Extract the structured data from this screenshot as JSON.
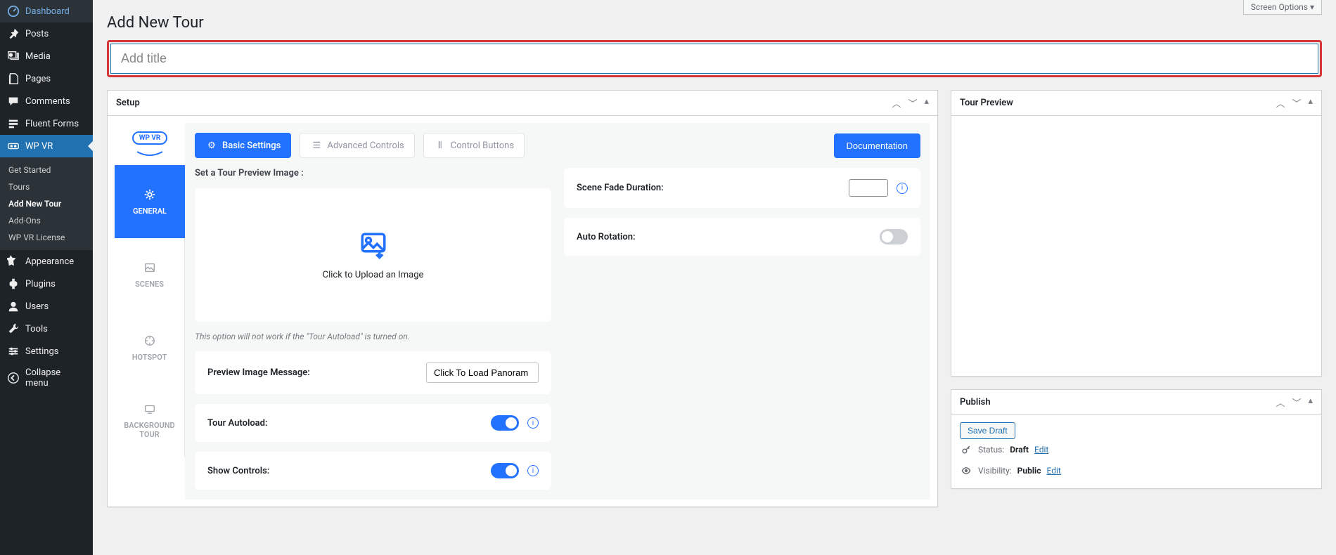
{
  "screen_options": "Screen Options ▾",
  "page_title": "Add New Tour",
  "title_placeholder": "Add title",
  "sidebar": [
    {
      "icon": "dashboard",
      "label": "Dashboard"
    },
    {
      "icon": "pin",
      "label": "Posts"
    },
    {
      "icon": "media",
      "label": "Media"
    },
    {
      "icon": "pages",
      "label": "Pages"
    },
    {
      "icon": "comments",
      "label": "Comments"
    },
    {
      "icon": "forms",
      "label": "Fluent Forms"
    },
    {
      "icon": "vr",
      "label": "WP VR"
    }
  ],
  "wpvr_sub": [
    "Get Started",
    "Tours",
    "Add New Tour",
    "Add-Ons",
    "WP VR License"
  ],
  "sidebar2": [
    {
      "icon": "appearance",
      "label": "Appearance"
    },
    {
      "icon": "plugins",
      "label": "Plugins"
    },
    {
      "icon": "users",
      "label": "Users"
    },
    {
      "icon": "tools",
      "label": "Tools"
    },
    {
      "icon": "settings",
      "label": "Settings"
    },
    {
      "icon": "collapse",
      "label": "Collapse menu"
    }
  ],
  "setup": {
    "title": "Setup",
    "logo_text": "WP VR",
    "top_tabs": {
      "basic": "Basic Settings",
      "advanced": "Advanced Controls",
      "control": "Control Buttons"
    },
    "doc_btn": "Documentation",
    "side_tabs": {
      "general": "GENERAL",
      "scenes": "SCENES",
      "hotspot": "HOTSPOT",
      "bg": "BACKGROUND TOUR"
    },
    "preview_label": "Set a Tour Preview Image :",
    "upload_text": "Click to Upload an Image",
    "upload_hint": "This option will not work if the \"Tour Autoload\" is turned on.",
    "msg_label": "Preview Image Message:",
    "msg_value": "Click To Load Panoram",
    "autoload_label": "Tour Autoload:",
    "controls_label": "Show Controls:",
    "fade_label": "Scene Fade Duration:",
    "rotation_label": "Auto Rotation:"
  },
  "preview": {
    "title": "Tour Preview"
  },
  "publish": {
    "title": "Publish",
    "save_draft": "Save Draft",
    "status_label": "Status:",
    "status_value": "Draft",
    "visibility_label": "Visibility:",
    "visibility_value": "Public",
    "edit": "Edit"
  }
}
